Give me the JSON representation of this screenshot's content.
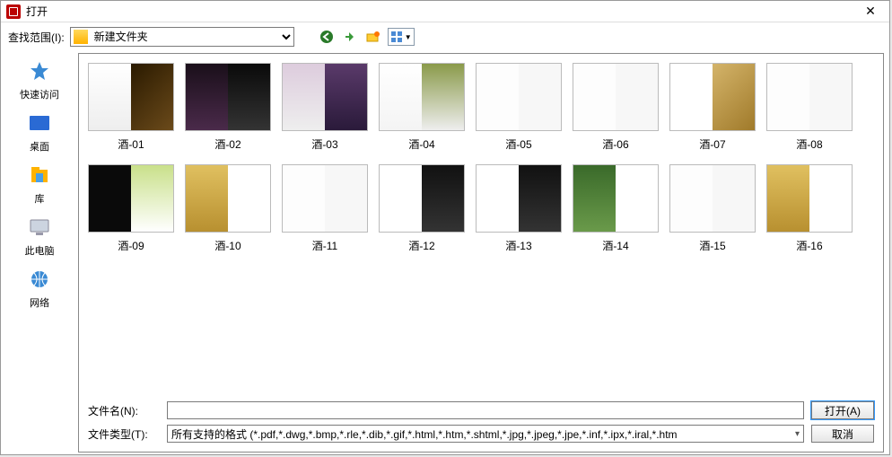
{
  "window": {
    "title": "打开"
  },
  "toolbar": {
    "lookin_label": "查找范围(I):",
    "current_folder": "新建文件夹",
    "icons": {
      "back": "back-icon",
      "up": "up-icon",
      "newfolder": "new-folder-icon",
      "views": "views-icon"
    }
  },
  "places": [
    {
      "label": "快速访问",
      "icon": "quickaccess"
    },
    {
      "label": "桌面",
      "icon": "desktop"
    },
    {
      "label": "库",
      "icon": "libraries"
    },
    {
      "label": "此电脑",
      "icon": "thispc"
    },
    {
      "label": "网络",
      "icon": "network"
    }
  ],
  "files": [
    {
      "name": "酒-01",
      "thumb": "th-a"
    },
    {
      "name": "酒-02",
      "thumb": "th-b"
    },
    {
      "name": "酒-03",
      "thumb": "th-c"
    },
    {
      "name": "酒-04",
      "thumb": "th-d"
    },
    {
      "name": "酒-05",
      "thumb": "th-e"
    },
    {
      "name": "酒-06",
      "thumb": "th-e"
    },
    {
      "name": "酒-07",
      "thumb": "th-f"
    },
    {
      "name": "酒-08",
      "thumb": "th-e"
    },
    {
      "name": "酒-09",
      "thumb": "th-g"
    },
    {
      "name": "酒-10",
      "thumb": "th-h"
    },
    {
      "name": "酒-11",
      "thumb": "th-e"
    },
    {
      "name": "酒-12",
      "thumb": "th-i"
    },
    {
      "name": "酒-13",
      "thumb": "th-i"
    },
    {
      "name": "酒-14",
      "thumb": "th-j"
    },
    {
      "name": "酒-15",
      "thumb": "th-e"
    },
    {
      "name": "酒-16",
      "thumb": "th-h"
    }
  ],
  "bottom": {
    "filename_label": "文件名(N):",
    "filetype_label": "文件类型(T):",
    "filename_value": "",
    "filetype_value": "所有支持的格式 (*.pdf,*.dwg,*.bmp,*.rle,*.dib,*.gif,*.html,*.htm,*.shtml,*.jpg,*.jpeg,*.jpe,*.inf,*.ipx,*.iral,*.htm",
    "open_btn": "打开(A)",
    "cancel_btn": "取消"
  }
}
